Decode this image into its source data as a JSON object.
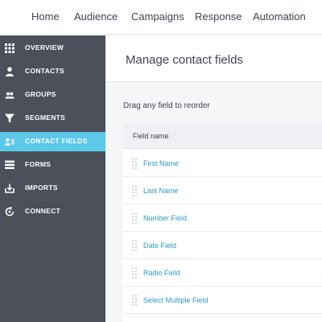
{
  "topnav": {
    "items": [
      "Home",
      "Audience",
      "Campaigns",
      "Response",
      "Automation"
    ]
  },
  "sidebar": {
    "items": [
      {
        "label": "OVERVIEW",
        "icon": "grid-icon"
      },
      {
        "label": "CONTACTS",
        "icon": "person-icon"
      },
      {
        "label": "GROUPS",
        "icon": "group-icon"
      },
      {
        "label": "SEGMENTS",
        "icon": "funnel-icon"
      },
      {
        "label": "CONTACT FIELDS",
        "icon": "contact-fields-icon",
        "active": true
      },
      {
        "label": "FORMS",
        "icon": "forms-icon"
      },
      {
        "label": "IMPORTS",
        "icon": "import-icon"
      },
      {
        "label": "CONNECT",
        "icon": "connect-icon"
      }
    ]
  },
  "main": {
    "title": "Manage contact fields",
    "hint": "Drag any field to reorder",
    "table": {
      "header": "Field name",
      "rows": [
        "First Name",
        "Last Name",
        "Number Field",
        "Date Field",
        "Radio Field",
        "Select Multiple Field"
      ]
    }
  },
  "colors": {
    "sidebar_bg": "#4b505b",
    "active_bg": "#5cc8ea",
    "link": "#2d9cc6",
    "text": "#3e4451"
  }
}
